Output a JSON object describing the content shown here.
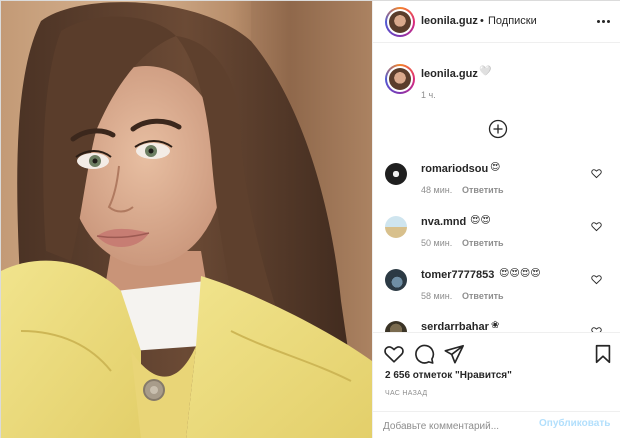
{
  "post": {
    "image_alt": "Selfie of a woman with long brown hair in a yellow jacket"
  },
  "header": {
    "username": "leonila.guz",
    "separator": "•",
    "follow_label": "Подписки",
    "more_icon": "more-horizontal-icon"
  },
  "caption": {
    "username": "leonila.guz",
    "emoji": "🤍",
    "time": "1 ч."
  },
  "load_more_icon": "plus-circle-icon",
  "comments": [
    {
      "username": "romariodsou",
      "emoji": "😍",
      "time": "48 мин.",
      "reply_label": "Ответить"
    },
    {
      "username": "nva.mnd",
      "emoji": "😍😍",
      "time": "50 мин.",
      "reply_label": "Ответить"
    },
    {
      "username": "tomer7777853",
      "emoji": "😍😍😍😍",
      "time": "58 мин.",
      "reply_label": "Ответить"
    },
    {
      "username": "serdarrbahar",
      "emoji": "❀",
      "time": "",
      "reply_label": ""
    }
  ],
  "actions": {
    "like_icon": "heart-icon",
    "comment_icon": "comment-icon",
    "share_icon": "send-icon",
    "save_icon": "bookmark-icon",
    "likes_text": "2 656 отметок \"Нравится\"",
    "post_time": "ЧАС НАЗАД"
  },
  "comment_form": {
    "placeholder": "Добавьте комментарий...",
    "publish_label": "Опубликовать"
  },
  "colors": {
    "text": "#262626",
    "muted": "#8e8e8e",
    "border": "#dbdbdb",
    "publish_disabled": "#b2dffc"
  }
}
